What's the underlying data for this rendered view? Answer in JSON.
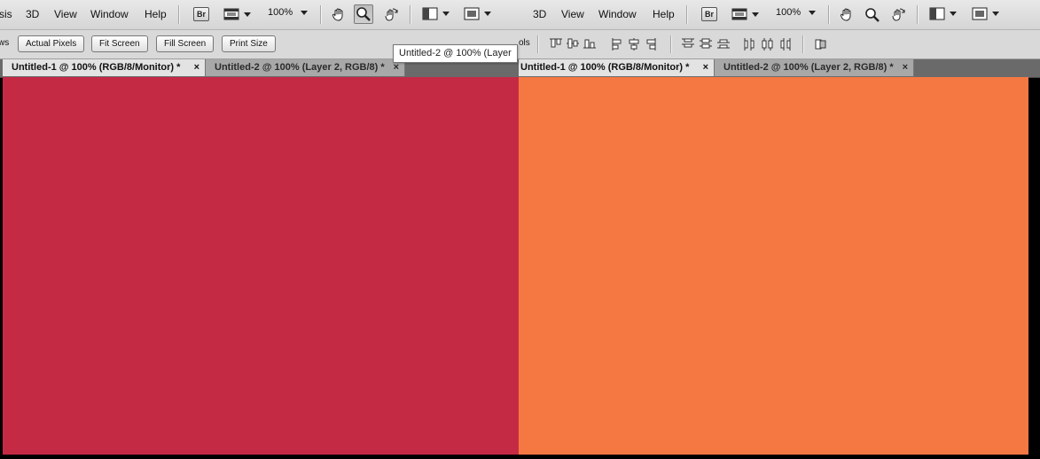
{
  "left_window": {
    "menu": [
      "sis",
      "3D",
      "View",
      "Window",
      "Help"
    ],
    "zoom": "100%",
    "options": {
      "partial_label": "ws",
      "buttons": [
        "Actual Pixels",
        "Fit Screen",
        "Fill Screen",
        "Print Size"
      ]
    },
    "tabs": [
      {
        "label": "Untitled-1 @ 100% (RGB/8/Monitor) *",
        "close": "×"
      },
      {
        "label": "Untitled-2 @ 100% (Layer 2, RGB/8) *",
        "close": "×"
      }
    ],
    "canvas_color": "#c52a45"
  },
  "right_window": {
    "menu": [
      "3D",
      "View",
      "Window",
      "Help"
    ],
    "zoom": "100%",
    "options": {
      "partial_label": "ols"
    },
    "tabs": [
      {
        "label": "Untitled-1 @ 100% (RGB/8/Monitor) *",
        "close": "×"
      },
      {
        "label": "Untitled-2 @ 100% (Layer 2, RGB/8) *",
        "close": "×"
      }
    ],
    "canvas_color": "#f57842"
  },
  "tooltip": "Untitled-2 @ 100% (Layer",
  "icons": {
    "bridge": "Br",
    "tools": [
      "hand-icon",
      "zoom-icon",
      "rotate-view-icon",
      "arrange-documents-icon",
      "screen-mode-icon"
    ]
  }
}
